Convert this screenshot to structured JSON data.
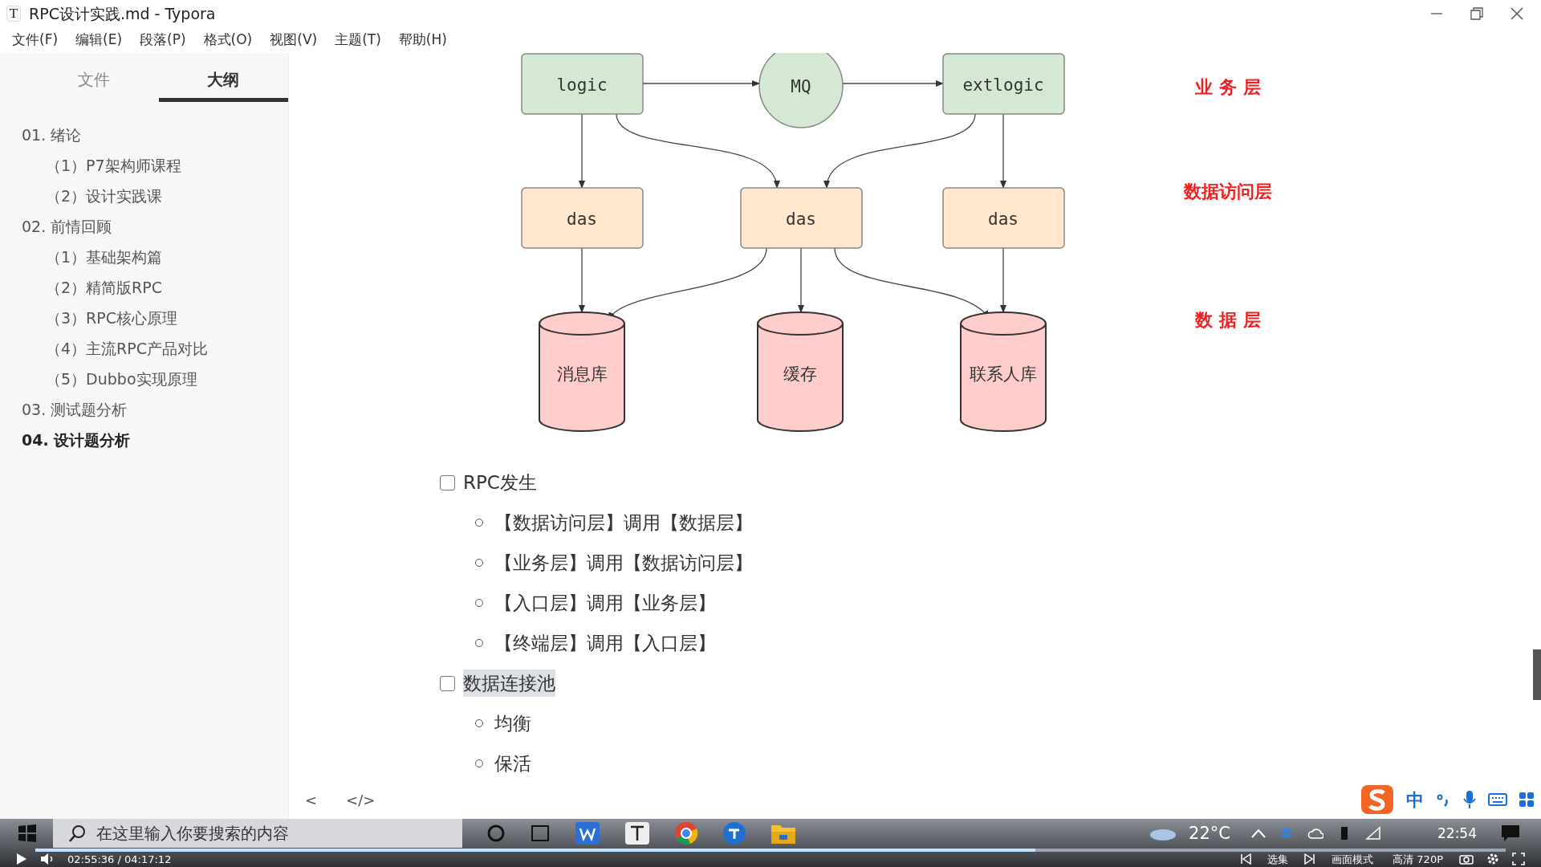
{
  "window": {
    "title": "RPC设计实践.md - Typora",
    "app_icon": "T"
  },
  "menu": [
    "文件(F)",
    "编辑(E)",
    "段落(P)",
    "格式(O)",
    "视图(V)",
    "主题(T)",
    "帮助(H)"
  ],
  "sidebar": {
    "tabs": [
      {
        "label": "文件",
        "selected": false
      },
      {
        "label": "大纲",
        "selected": true
      }
    ],
    "outline": [
      {
        "label": "01. 绪论",
        "selected": false,
        "children": [
          {
            "label": "（1）P7架构师课程",
            "selected": false
          },
          {
            "label": "（2）设计实践课",
            "selected": false
          }
        ]
      },
      {
        "label": "02. 前情回顾",
        "selected": false,
        "children": [
          {
            "label": "（1）基础架构篇",
            "selected": false
          },
          {
            "label": "（2）精简版RPC",
            "selected": false
          },
          {
            "label": "（3）RPC核心原理",
            "selected": false
          },
          {
            "label": "（4）主流RPC产品对比",
            "selected": false
          },
          {
            "label": "（5）Dubbo实现原理",
            "selected": false
          }
        ]
      },
      {
        "label": "03. 测试题分析",
        "selected": false
      },
      {
        "label": "04. 设计题分析",
        "selected": true
      }
    ],
    "footer_buttons": [
      "<",
      "</>"
    ]
  },
  "diagram": {
    "nodes": [
      {
        "label": "logic",
        "kind": "box",
        "color": "#d5e8d4"
      },
      {
        "label": "MQ",
        "kind": "circle",
        "color": "#d5e8d4"
      },
      {
        "label": "extlogic",
        "kind": "box",
        "color": "#d5e8d4"
      },
      {
        "label": "das",
        "kind": "box",
        "color": "#ffe6cc"
      },
      {
        "label": "das",
        "kind": "box",
        "color": "#ffe6cc"
      },
      {
        "label": "das",
        "kind": "box",
        "color": "#ffe6cc"
      },
      {
        "label": "消息库",
        "kind": "cylinder",
        "color": "#ffcccc"
      },
      {
        "label": "缓存",
        "kind": "cylinder",
        "color": "#ffcccc"
      },
      {
        "label": "联系人库",
        "kind": "cylinder",
        "color": "#ffcccc"
      }
    ],
    "layers": [
      "业 务 层",
      "数据访问层",
      "数 据 层"
    ]
  },
  "tasks": [
    {
      "label": "RPC发生",
      "checked": false,
      "highlighted": false,
      "children": [
        "【数据访问层】调用【数据层】",
        "【业务层】调用【数据访问层】",
        "【入口层】调用【业务层】",
        "【终端层】调用【入口层】"
      ]
    },
    {
      "label": "数据连接池",
      "checked": false,
      "highlighted": true,
      "children": [
        "均衡",
        "保活"
      ]
    }
  ],
  "taskbar": {
    "search": {
      "placeholder": "在这里输入你要搜索的内容"
    },
    "weather": "22°C",
    "clock": "22:54"
  },
  "ime": {
    "mode": "中"
  },
  "player": {
    "time": "02:55:36 / 04:17:12",
    "level": 0.68,
    "buttons": [
      "选集",
      "画面模式",
      "高清 720P"
    ]
  }
}
